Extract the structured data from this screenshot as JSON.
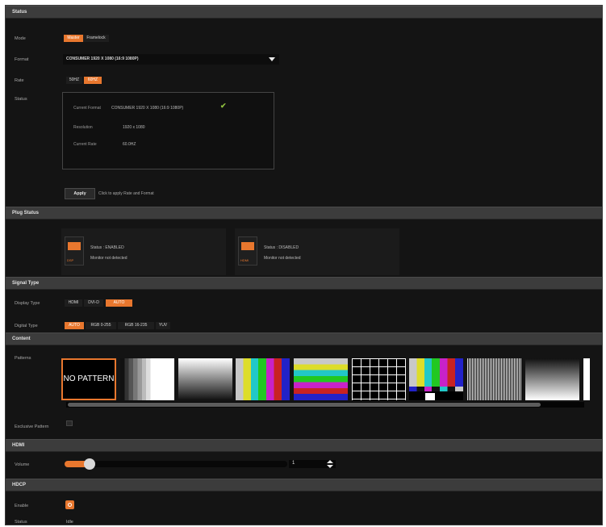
{
  "sections": {
    "status": "Status",
    "plug": "Plug Status",
    "signal": "Signal Type",
    "content": "Content",
    "hdmi": "HDMI",
    "hdcp": "HDCP"
  },
  "status": {
    "mode_label": "Mode",
    "mode_options": [
      "Master",
      "Framelock"
    ],
    "format_label": "Format",
    "format_value": "CONSUMER 1920 X 1080 (16:9 1080P)",
    "rate_label": "Rate",
    "rate_options": [
      "50HZ",
      "60HZ"
    ],
    "status_label": "Status",
    "current_format_label": "Current Format",
    "current_format_value": "CONSUMER 1920 X 1080 (16:9 1080P)",
    "resolution_label": "Resolution",
    "resolution_value": "1920 x 1080",
    "current_rate_label": "Current Rate",
    "current_rate_value": "60.0HZ",
    "apply_label": "Apply",
    "apply_hint": "Click to apply Rate and Format"
  },
  "plug": {
    "ports": [
      {
        "name": "DSP",
        "status": "Status : ENABLED",
        "monitor": "Monitor not detected"
      },
      {
        "name": "HDMI",
        "status": "Status : DISABLED",
        "monitor": "Monitor not detected"
      }
    ]
  },
  "signal": {
    "display_type_label": "Display Type",
    "display_types": [
      "HDMI",
      "DVI-D",
      "AUTO"
    ],
    "digital_type_label": "Digital Type",
    "digital_types": [
      "AUTO",
      "RGB 0-255",
      "RGB 16-235",
      "YUV"
    ]
  },
  "content": {
    "patterns_label": "Patterns",
    "no_pattern_label": "NO PATTERN",
    "exclusive_label": "Exclusive Pattern"
  },
  "hdmi": {
    "volume_label": "Volume",
    "volume_value": "1",
    "volume_level": 0.09
  },
  "hdcp": {
    "enable_label": "Enable",
    "status_label": "Status",
    "status_value": "Idle"
  },
  "colors": {
    "accent": "#e8772e",
    "check": "#8fbf3f",
    "background": "#141414"
  }
}
